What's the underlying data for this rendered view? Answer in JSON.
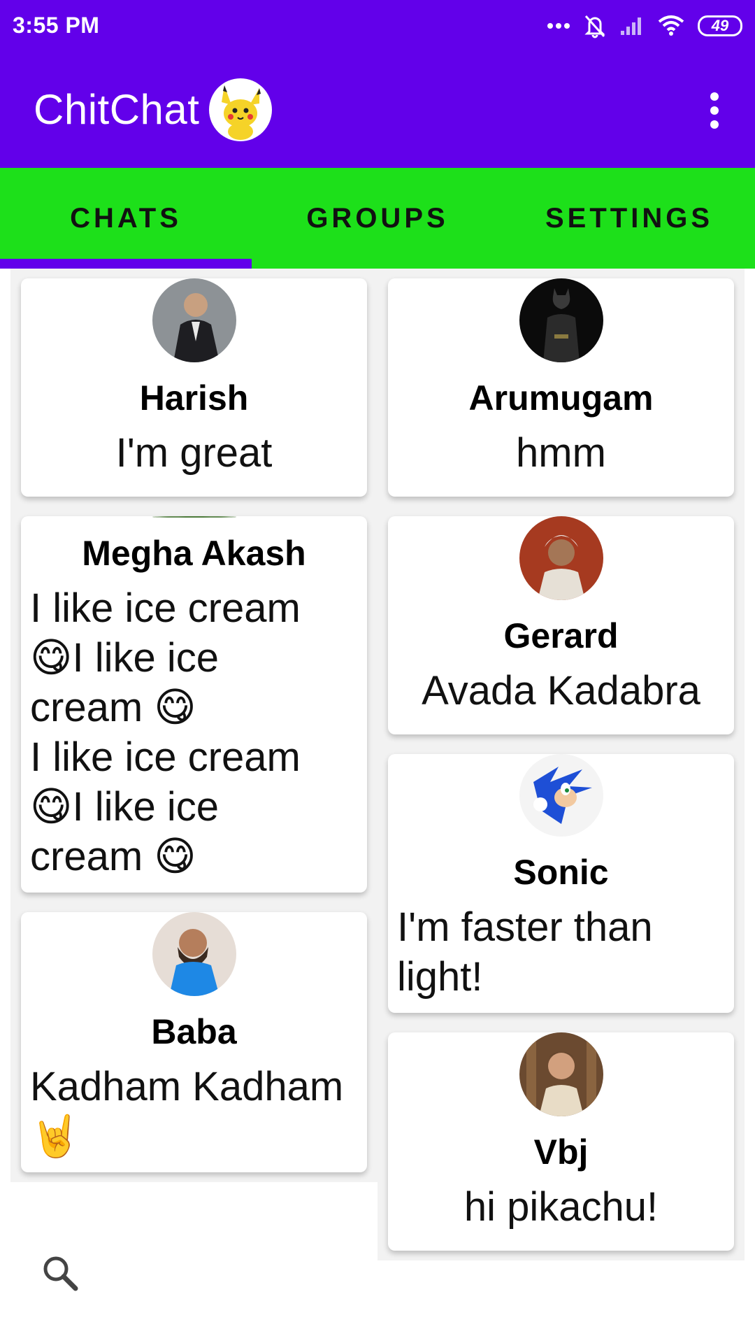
{
  "status_bar": {
    "time": "3:55 PM",
    "battery": "49",
    "icons": [
      "more-dots-icon",
      "bell-off-icon",
      "signal-icon",
      "wifi-icon",
      "battery-icon"
    ]
  },
  "app_bar": {
    "title": "ChitChat",
    "logo": "pikachu-logo",
    "menu_icon": "more-vert-icon"
  },
  "tabs": [
    {
      "label": "CHATS",
      "selected": true
    },
    {
      "label": "GROUPS",
      "selected": false
    },
    {
      "label": "SETTINGS",
      "selected": false
    }
  ],
  "chats": [
    {
      "name": "Harish",
      "message": "I'm great"
    },
    {
      "name": "Arumugam",
      "message": "hmm"
    },
    {
      "name": "Megha Akash",
      "message_lines": [
        "I like ice cream",
        "😋I like ice",
        "cream 😋",
        "I like ice cream",
        "😋I like ice",
        "cream 😋"
      ]
    },
    {
      "name": "Gerard",
      "message": "Avada Kadabra"
    },
    {
      "name": "Sonic",
      "message_lines": [
        "I'm faster than",
        "light!"
      ]
    },
    {
      "name": "Baba",
      "message_lines": [
        "Kadham Kadham",
        "🤘"
      ]
    },
    {
      "name": "Vbj",
      "message": "hi pikachu!"
    }
  ],
  "colors": {
    "primary": "#6200EA",
    "tab_bar": "#1DE01A",
    "text": "#000000"
  }
}
